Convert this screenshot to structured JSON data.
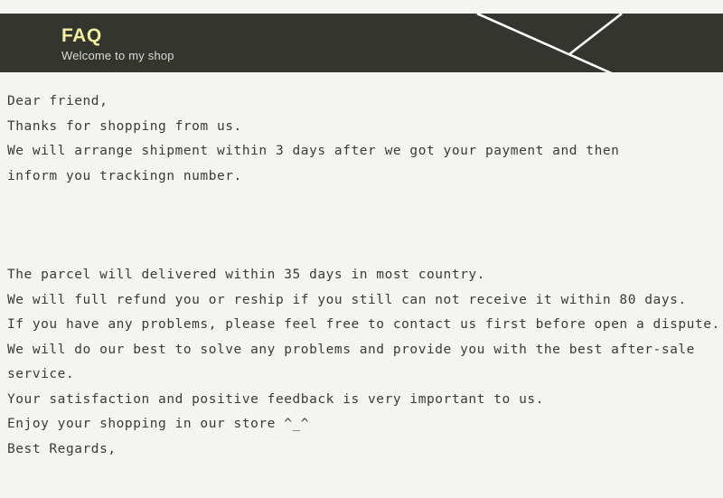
{
  "banner": {
    "title": "FAQ",
    "subtitle": "Welcome to my shop",
    "background_color": "#34352e",
    "title_color": "#f2ef9e",
    "subtitle_color": "#dcdcd8",
    "decoration": "diagonal-white-lines"
  },
  "page": {
    "background_color": "#f4f4f2",
    "text_color": "#3a3a38"
  },
  "content": {
    "paragraph1": [
      "Dear friend,",
      "Thanks for shopping from us.",
      "We will arrange shipment within 3 days after we got your payment and then",
      "inform you trackingn number."
    ],
    "paragraph2": [
      "The parcel will delivered within 35 days in most country.",
      "We will full refund you or reship if you still can not receive it within 80 days.",
      "If you have any problems, please feel free to contact us first before open a dispute.",
      "We will do our best to solve any problems and provide you with the best after-sale",
      "service.",
      "Your satisfaction and positive feedback is very important to us.",
      "Enjoy your shopping in our store ^_^",
      "Best Regards,"
    ]
  }
}
